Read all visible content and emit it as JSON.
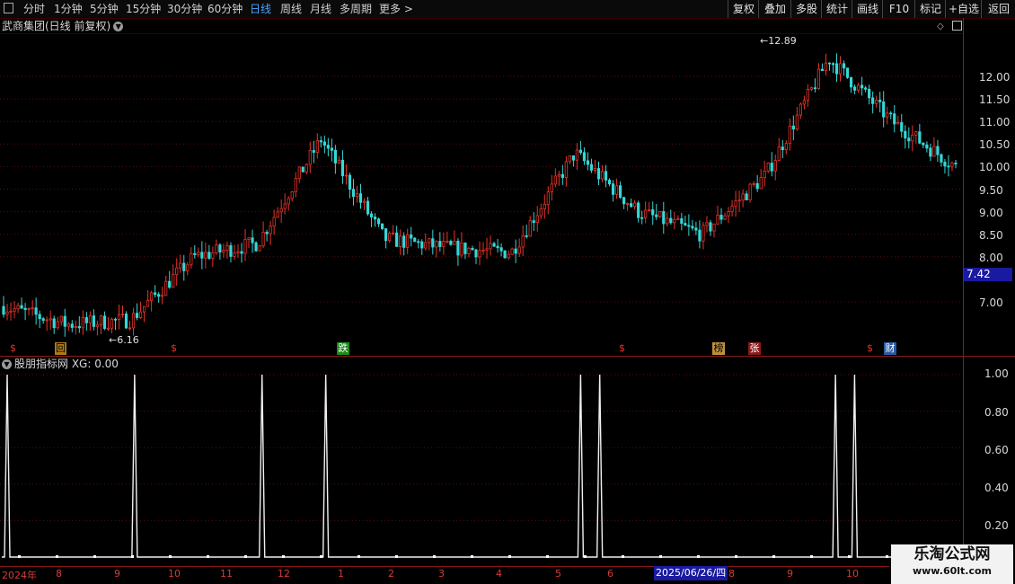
{
  "toolbar": {
    "periods": [
      "分时",
      "1分钟",
      "5分钟",
      "15分钟",
      "30分钟",
      "60分钟",
      "日线",
      "周线",
      "月线",
      "多周期",
      "更多 >"
    ],
    "active_period": "日线",
    "right_buttons": [
      "复权",
      "叠加",
      "多股",
      "统计",
      "画线",
      "F10",
      "标记",
      "+自选",
      "返回"
    ]
  },
  "main_panel": {
    "title": "武商集团(日线 前复权)",
    "current_price": "7.42",
    "high_label": "12.89",
    "low_label": "6.16"
  },
  "indicator_panel": {
    "title": "股朋指标网 XG: 0.00"
  },
  "event_markers": [
    "$",
    "回",
    "$",
    "跌",
    "$",
    "榜",
    "张",
    "$",
    "财"
  ],
  "x_axis": {
    "start": "2024年",
    "months": [
      "8",
      "9",
      "10",
      "11",
      "12",
      "1",
      "2",
      "3",
      "4",
      "5",
      "6",
      "7",
      "8",
      "9",
      "10"
    ],
    "cursor_date": "2025/06/26/四"
  },
  "watermark": {
    "line1": "乐淘公式网",
    "line2": "www.60lt.com"
  },
  "colors": {
    "up": "#e8342a",
    "down": "#35d7d7",
    "grid": "#5a0c0c",
    "active": "#4aa3ff",
    "axis_text": "#d63a3a"
  },
  "chart_data": [
    {
      "type": "candlestick",
      "series": [
        {
          "name": "武商集团"
        }
      ],
      "y_ticks": [
        7.0,
        8.0,
        8.5,
        9.0,
        9.5,
        10.0,
        10.5,
        11.0,
        11.5,
        12.0
      ],
      "ylim": [
        6.0,
        13.0
      ],
      "close_trend": [
        [
          "2024-07",
          6.9
        ],
        [
          "2024-08",
          6.5
        ],
        [
          "2024-09",
          6.6
        ],
        [
          "2024-10",
          8.0
        ],
        [
          "2024-11",
          8.3
        ],
        [
          "2024-12",
          10.6
        ],
        [
          "2025-01",
          8.4
        ],
        [
          "2025-02",
          8.2
        ],
        [
          "2025-03",
          8.1
        ],
        [
          "2025-04",
          10.3
        ],
        [
          "2025-05",
          9.0
        ],
        [
          "2025-06",
          8.5
        ],
        [
          "2025-07",
          9.8
        ],
        [
          "2025-08",
          12.4
        ],
        [
          "2025-09",
          11.0
        ],
        [
          "2025-10",
          10.0
        ]
      ],
      "high": 12.89,
      "low": 6.16,
      "last": 7.42
    },
    {
      "type": "line",
      "series": [
        {
          "name": "XG"
        }
      ],
      "y_ticks": [
        0.2,
        0.4,
        0.6,
        0.8,
        1.0
      ],
      "ylim": [
        0,
        1.05
      ],
      "signal_months": [
        "2024-07",
        "2024-09",
        "2024-11",
        "2024-12",
        "2025-04",
        "2025-04",
        "2025-08",
        "2025-08"
      ],
      "current": 0.0
    }
  ]
}
